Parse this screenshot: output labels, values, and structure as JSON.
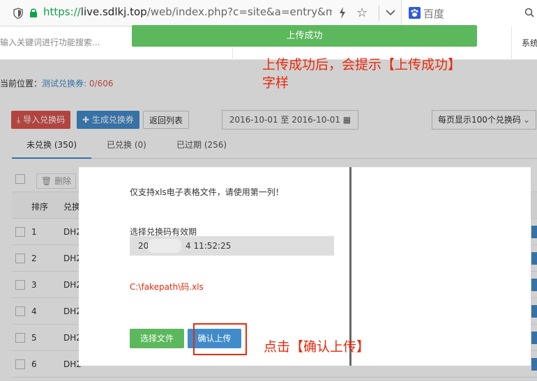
{
  "browser": {
    "url_proto": "https://",
    "url_host": "live.sdlkj.top",
    "url_path": "/web/index.php?c=site&a=entry&m=ewe",
    "search_engine": "百度"
  },
  "topbar": {
    "func_search_placeholder": "输入关键词进行功能搜索...",
    "system_label": "系统"
  },
  "toast": {
    "message": "上传成功"
  },
  "annotations": {
    "success_note_line1": "上传成功后，会提示【上传成功】",
    "success_note_line2": "字样",
    "confirm_note": "点击【确认上传】"
  },
  "breadcrumb": {
    "prefix": "当前位置：",
    "link": "测试兑换券:",
    "count": "0/606"
  },
  "toolbar": {
    "import_label": "导入兑换码",
    "generate_label": "生成兑换券",
    "back_label": "返回列表",
    "date_range": "2016-10-01 至 2016-10-01",
    "per_page": "每页显示100个兑换码"
  },
  "tabs": [
    {
      "label": "未兑换 (350)"
    },
    {
      "label": "已兑换 (0)"
    },
    {
      "label": "已过期 (256)"
    }
  ],
  "table": {
    "delete_label": "删除",
    "header_num": "排序",
    "header_code": "兑换",
    "rows": [
      {
        "num": "1",
        "code": "DH2"
      },
      {
        "num": "2",
        "code": "DH2"
      },
      {
        "num": "3",
        "code": "DH2"
      },
      {
        "num": "4",
        "code": "DH2"
      },
      {
        "num": "5",
        "code": "DH2"
      },
      {
        "num": "6",
        "code": "DH2"
      }
    ]
  },
  "dialog": {
    "note": "仅支持xls电子表格文件，请使用第一列！",
    "valid_label": "选择兑换码有效期",
    "datetime_prefix": "20",
    "datetime_suffix": "4 11:52:25",
    "file_path": "C:\\fakepath\\码.xls",
    "choose_label": "选择文件",
    "confirm_label": "确认上传"
  },
  "colors": {
    "success_green": "#5cb85c",
    "primary_blue": "#428bca",
    "danger_red": "#d9534f",
    "annotation_red": "#e8290b"
  }
}
